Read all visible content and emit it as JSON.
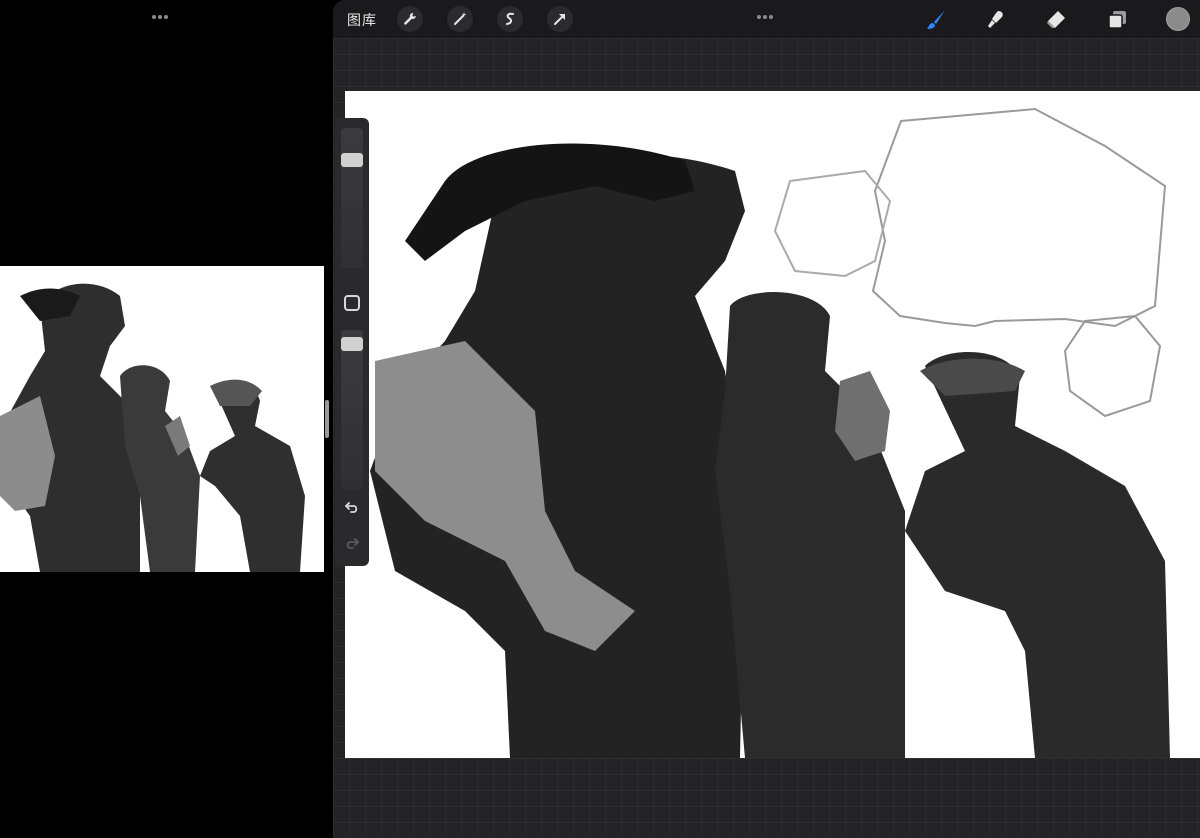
{
  "left_pane": {
    "reference_image_alt": ""
  },
  "toolbar": {
    "gallery_label": "图库",
    "tools_left": [
      {
        "icon": "wrench-icon"
      },
      {
        "icon": "magic-wand-icon"
      },
      {
        "icon": "selection-icon"
      },
      {
        "icon": "transform-arrow-icon"
      }
    ],
    "tools_right": [
      {
        "icon": "brush-icon",
        "active": true
      },
      {
        "icon": "smudge-icon"
      },
      {
        "icon": "eraser-icon"
      },
      {
        "icon": "layers-icon"
      }
    ],
    "current_color": "#8b8b8b"
  },
  "colors": {
    "active_tool": "#2f86ff",
    "chrome_bg": "#1a1a1c",
    "canvas_bg": "#242426"
  },
  "sidebar": {
    "brush_size_level": 0.2,
    "opacity_level": 0.05
  }
}
